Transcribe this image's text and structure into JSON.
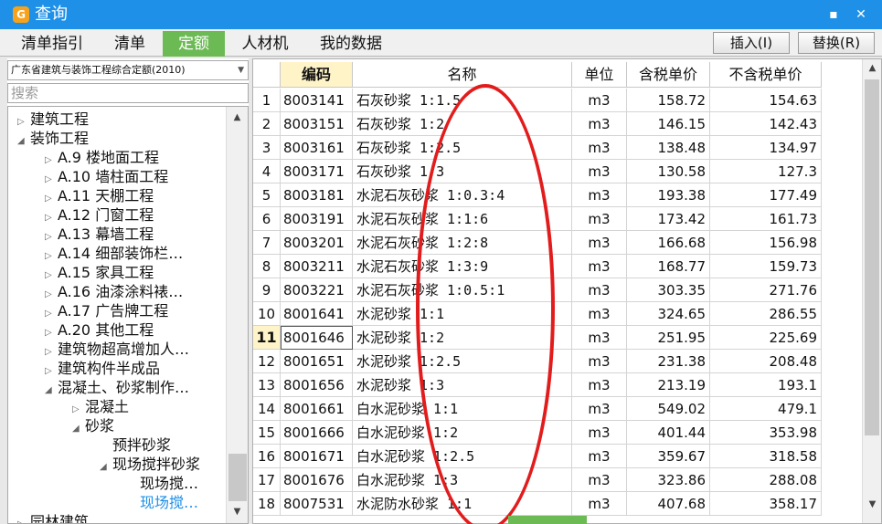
{
  "window": {
    "title": "查询",
    "minimize_glyph": "▪",
    "close_glyph": "✕"
  },
  "tabs": [
    "清单指引",
    "清单",
    "定额",
    "人材机",
    "我的数据"
  ],
  "active_tab": "定额",
  "toolbar": {
    "insert_label": "插入(I)",
    "replace_label": "替换(R)"
  },
  "left": {
    "quota_library": "广东省建筑与装饰工程综合定额(2010)",
    "search_placeholder": "搜索",
    "tree": [
      {
        "label": "建筑工程",
        "level": 0,
        "state": "collapsed"
      },
      {
        "label": "装饰工程",
        "level": 0,
        "state": "expanded"
      },
      {
        "label": "A.9 楼地面工程",
        "level": 1,
        "state": "collapsed"
      },
      {
        "label": "A.10 墙柱面工程",
        "level": 1,
        "state": "collapsed"
      },
      {
        "label": "A.11 天棚工程",
        "level": 1,
        "state": "collapsed"
      },
      {
        "label": "A.12 门窗工程",
        "level": 1,
        "state": "collapsed"
      },
      {
        "label": "A.13 幕墙工程",
        "level": 1,
        "state": "collapsed"
      },
      {
        "label": "A.14 细部装饰栏…",
        "level": 1,
        "state": "collapsed"
      },
      {
        "label": "A.15 家具工程",
        "level": 1,
        "state": "collapsed"
      },
      {
        "label": "A.16 油漆涂料裱…",
        "level": 1,
        "state": "collapsed"
      },
      {
        "label": "A.17 广告牌工程",
        "level": 1,
        "state": "collapsed"
      },
      {
        "label": "A.20 其他工程",
        "level": 1,
        "state": "collapsed"
      },
      {
        "label": "建筑物超高增加人…",
        "level": 1,
        "state": "collapsed"
      },
      {
        "label": "建筑构件半成品",
        "level": 1,
        "state": "collapsed"
      },
      {
        "label": "混凝土、砂浆制作…",
        "level": 1,
        "state": "expanded"
      },
      {
        "label": "混凝土",
        "level": 2,
        "state": "collapsed"
      },
      {
        "label": "砂浆",
        "level": 2,
        "state": "expanded"
      },
      {
        "label": "预拌砂浆",
        "level": 3,
        "state": "leaf"
      },
      {
        "label": "现场搅拌砂浆",
        "level": 3,
        "state": "expanded"
      },
      {
        "label": "现场搅…",
        "level": 4,
        "state": "leaf"
      },
      {
        "label": "现场搅…",
        "level": 4,
        "state": "leaf",
        "selected": true
      },
      {
        "label": "园林建筑",
        "level": 0,
        "state": "collapsed"
      }
    ]
  },
  "grid": {
    "columns": [
      "编码",
      "名称",
      "单位",
      "含税单价",
      "不含税单价"
    ],
    "active_row": 11,
    "rows": [
      {
        "n": "1",
        "code": "8003141",
        "name": "石灰砂浆 1:1.5",
        "unit": "m3",
        "tax": "158.72",
        "notax": "154.63"
      },
      {
        "n": "2",
        "code": "8003151",
        "name": "石灰砂浆 1:2",
        "unit": "m3",
        "tax": "146.15",
        "notax": "142.43"
      },
      {
        "n": "3",
        "code": "8003161",
        "name": "石灰砂浆 1:2.5",
        "unit": "m3",
        "tax": "138.48",
        "notax": "134.97"
      },
      {
        "n": "4",
        "code": "8003171",
        "name": "石灰砂浆 1:3",
        "unit": "m3",
        "tax": "130.58",
        "notax": "127.3"
      },
      {
        "n": "5",
        "code": "8003181",
        "name": "水泥石灰砂浆 1:0.3:4",
        "unit": "m3",
        "tax": "193.38",
        "notax": "177.49"
      },
      {
        "n": "6",
        "code": "8003191",
        "name": "水泥石灰砂浆 1:1:6",
        "unit": "m3",
        "tax": "173.42",
        "notax": "161.73"
      },
      {
        "n": "7",
        "code": "8003201",
        "name": "水泥石灰砂浆 1:2:8",
        "unit": "m3",
        "tax": "166.68",
        "notax": "156.98"
      },
      {
        "n": "8",
        "code": "8003211",
        "name": "水泥石灰砂浆 1:3:9",
        "unit": "m3",
        "tax": "168.77",
        "notax": "159.73"
      },
      {
        "n": "9",
        "code": "8003221",
        "name": "水泥石灰砂浆 1:0.5:1",
        "unit": "m3",
        "tax": "303.35",
        "notax": "271.76"
      },
      {
        "n": "10",
        "code": "8001641",
        "name": "水泥砂浆 1:1",
        "unit": "m3",
        "tax": "324.65",
        "notax": "286.55"
      },
      {
        "n": "11",
        "code": "8001646",
        "name": "水泥砂浆 1:2",
        "unit": "m3",
        "tax": "251.95",
        "notax": "225.69"
      },
      {
        "n": "12",
        "code": "8001651",
        "name": "水泥砂浆 1:2.5",
        "unit": "m3",
        "tax": "231.38",
        "notax": "208.48"
      },
      {
        "n": "13",
        "code": "8001656",
        "name": "水泥砂浆 1:3",
        "unit": "m3",
        "tax": "213.19",
        "notax": "193.1"
      },
      {
        "n": "14",
        "code": "8001661",
        "name": "白水泥砂浆 1:1",
        "unit": "m3",
        "tax": "549.02",
        "notax": "479.1"
      },
      {
        "n": "15",
        "code": "8001666",
        "name": "白水泥砂浆 1:2",
        "unit": "m3",
        "tax": "401.44",
        "notax": "353.98"
      },
      {
        "n": "16",
        "code": "8001671",
        "name": "白水泥砂浆 1:2.5",
        "unit": "m3",
        "tax": "359.67",
        "notax": "318.58"
      },
      {
        "n": "17",
        "code": "8001676",
        "name": "白水泥砂浆 1:3",
        "unit": "m3",
        "tax": "323.86",
        "notax": "288.08"
      },
      {
        "n": "18",
        "code": "8007531",
        "name": "水泥防水砂浆 1:1",
        "unit": "m3",
        "tax": "407.68",
        "notax": "358.17"
      }
    ]
  },
  "colors": {
    "titlebar": "#1e90e8",
    "active_tab": "#6cba54",
    "active_header": "#fff4c8",
    "annotation": "#e21c1c",
    "link": "#1e90e8"
  }
}
